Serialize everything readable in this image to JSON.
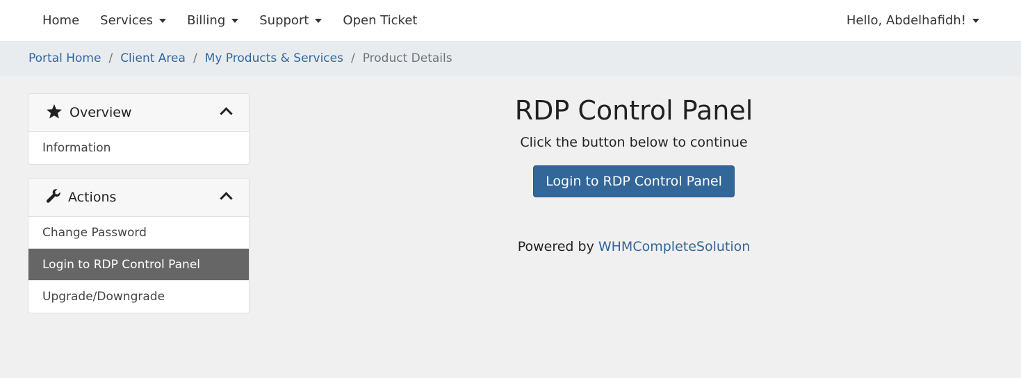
{
  "navbar": {
    "items": [
      {
        "label": "Home",
        "dropdown": false
      },
      {
        "label": "Services",
        "dropdown": true
      },
      {
        "label": "Billing",
        "dropdown": true
      },
      {
        "label": "Support",
        "dropdown": true
      },
      {
        "label": "Open Ticket",
        "dropdown": false
      }
    ],
    "user_menu": "Hello, Abdelhafidh!"
  },
  "breadcrumb": {
    "items": [
      "Portal Home",
      "Client Area",
      "My Products & Services"
    ],
    "separator": "/",
    "active": "Product Details"
  },
  "sidebar": {
    "overview": {
      "title": "Overview",
      "icon": "star-icon",
      "items": [
        "Information"
      ]
    },
    "actions": {
      "title": "Actions",
      "icon": "wrench-icon",
      "items": [
        "Change Password",
        "Login to RDP Control Panel",
        "Upgrade/Downgrade"
      ],
      "active_item": "Login to RDP Control Panel"
    }
  },
  "main": {
    "title": "RDP Control Panel",
    "subtitle": "Click the button below to continue",
    "button_label": "Login to RDP Control Panel",
    "powered_by_text": "Powered by",
    "powered_by_link": "WHMCompleteSolution"
  },
  "colors": {
    "accent": "#336699",
    "active_item_bg": "#666666",
    "breadcrumb_bg": "#e9ecef",
    "page_bg": "#f0f0f0"
  }
}
